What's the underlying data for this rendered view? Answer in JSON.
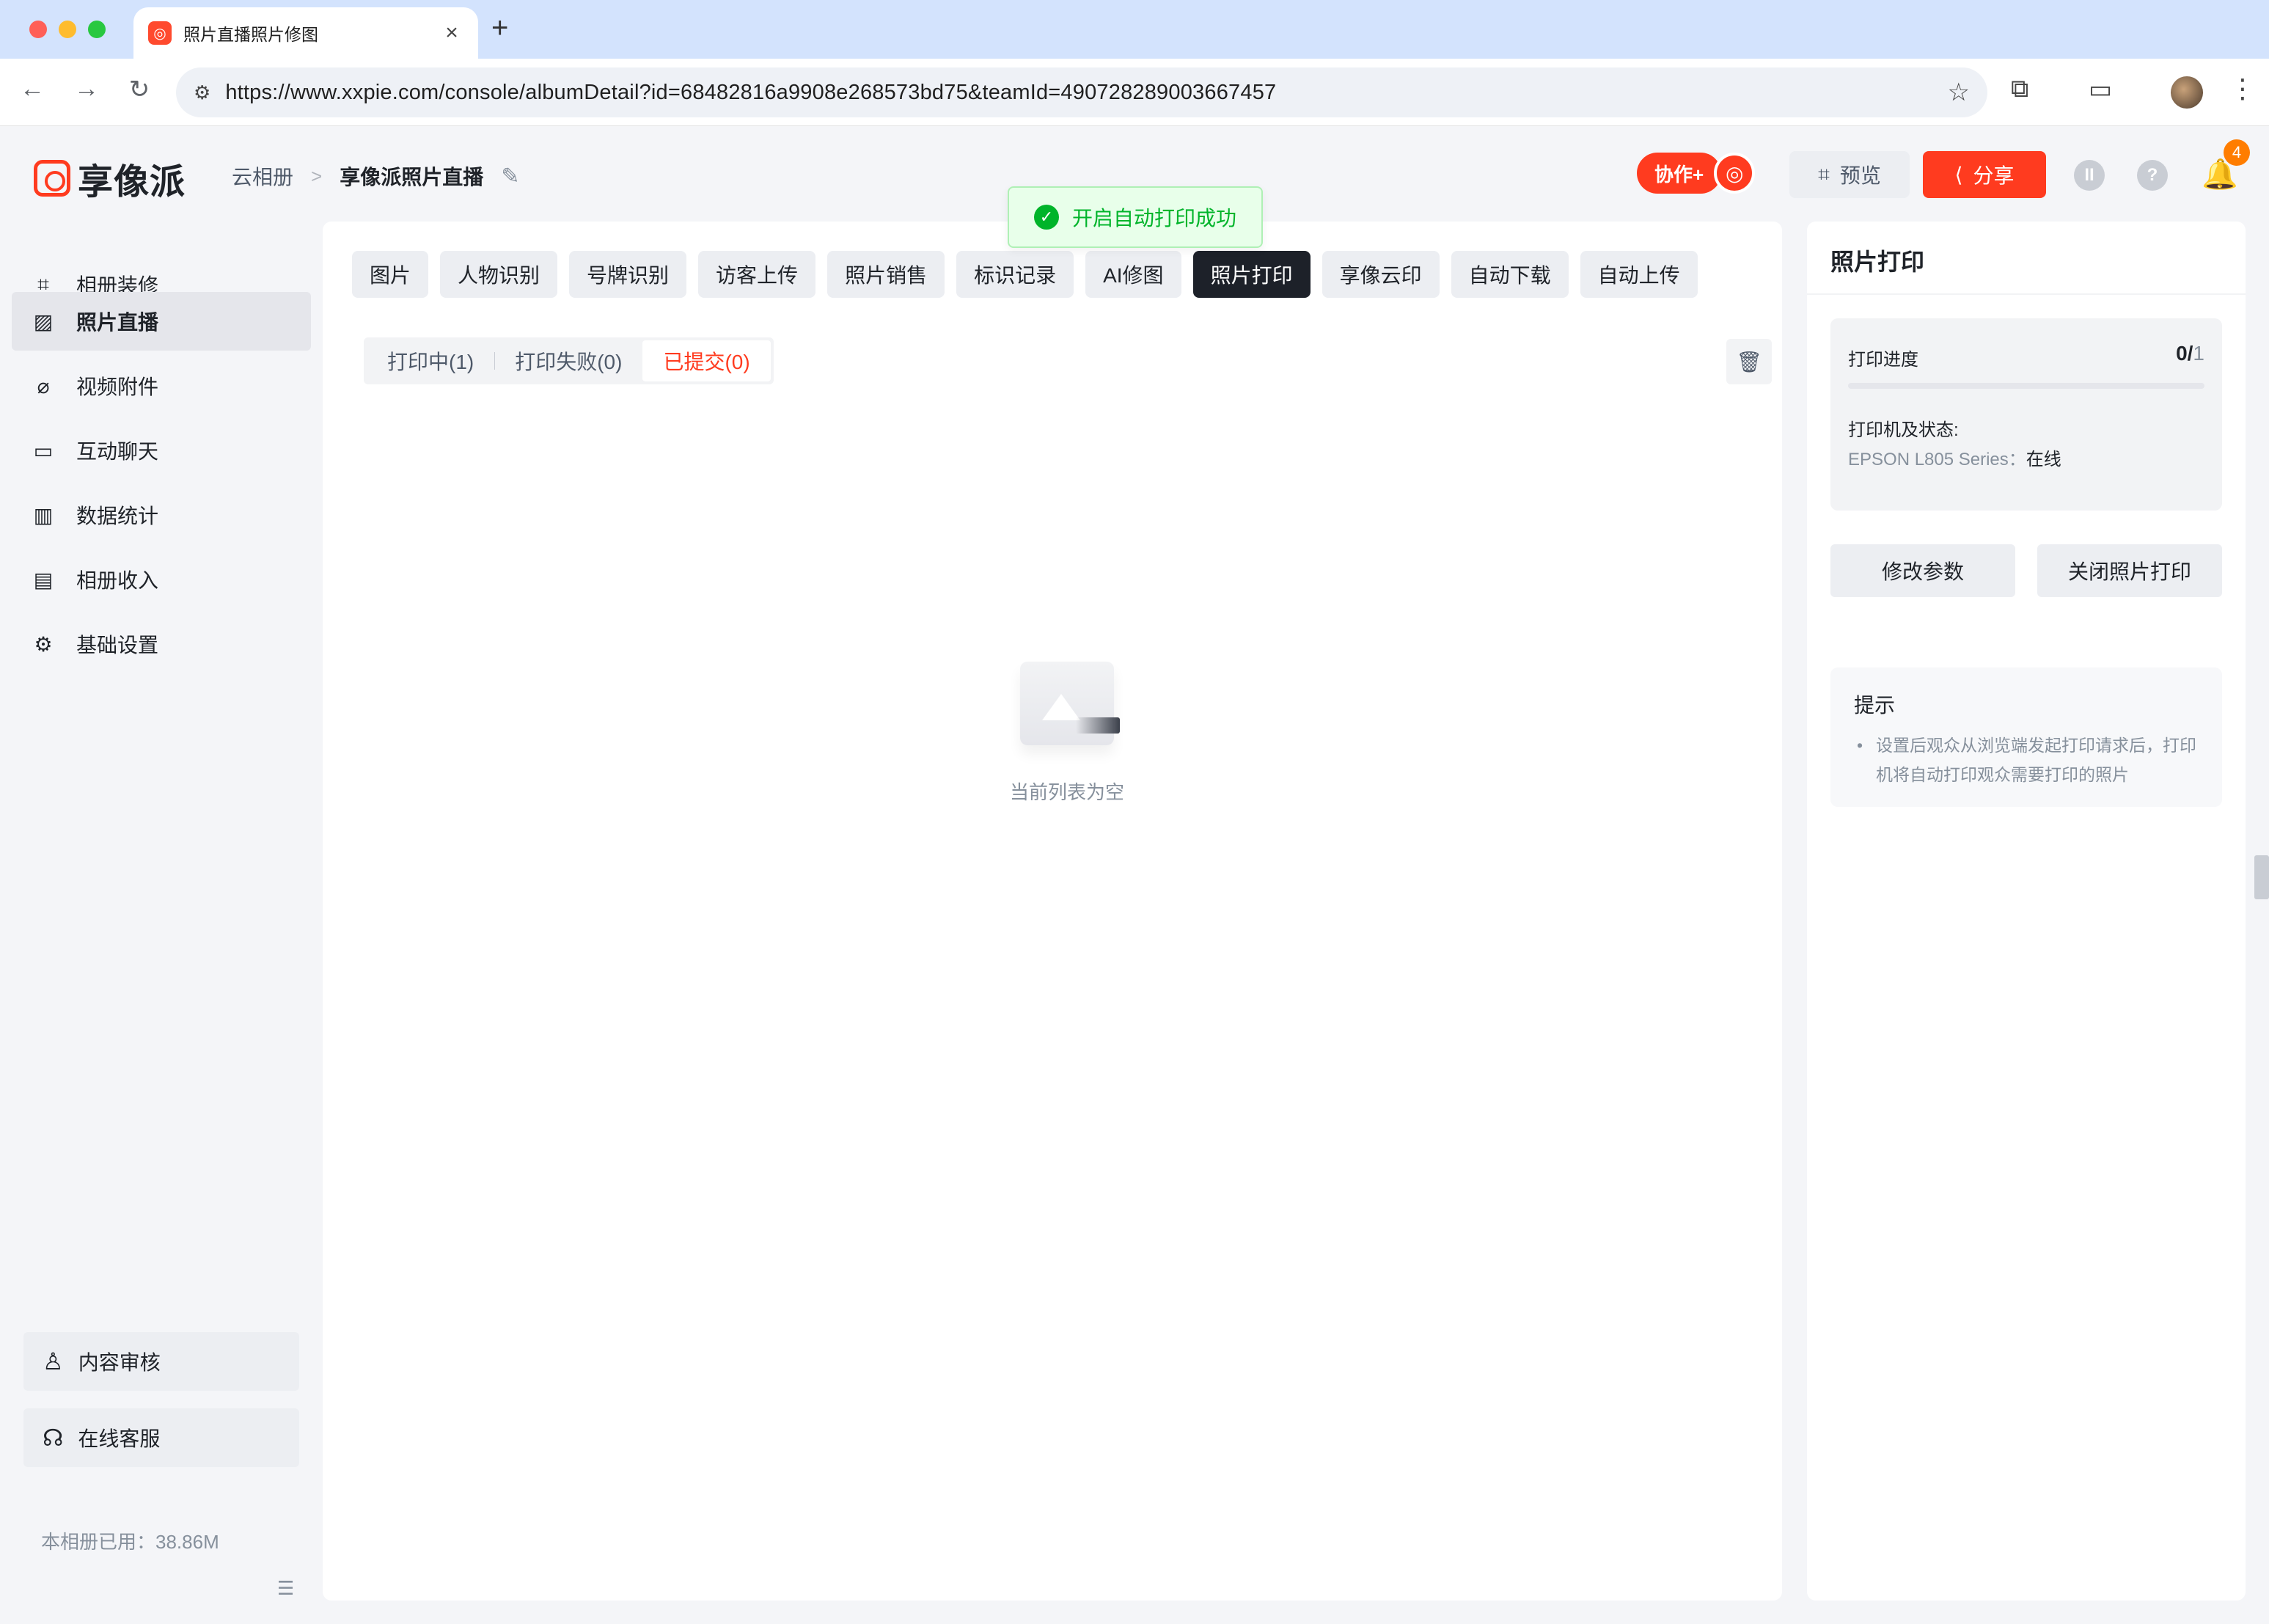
{
  "browser": {
    "tab_title": "照片直播照片修图",
    "tab_close": "×",
    "new_tab": "+",
    "url": "https://www.xxpie.com/console/albumDetail?id=68482816a9908e268573bd75&teamId=490728289003667457"
  },
  "header": {
    "logo_text": "享像派",
    "breadcrumb": [
      "云相册",
      "享像派照片直播"
    ],
    "breadcrumb_sep": ">",
    "collab_label": "协作+",
    "preview_label": "预览",
    "share_label": "分享",
    "notification_count": "4",
    "user_initial": "II",
    "help_glyph": "?"
  },
  "sidebar": {
    "items": [
      {
        "label": "相册装修",
        "icon": "decorate-icon"
      },
      {
        "label": "照片直播",
        "icon": "image-icon"
      },
      {
        "label": "视频附件",
        "icon": "paperclip-icon"
      },
      {
        "label": "互动聊天",
        "icon": "chat-icon"
      },
      {
        "label": "数据统计",
        "icon": "chart-icon"
      },
      {
        "label": "相册收入",
        "icon": "wallet-icon"
      },
      {
        "label": "基础设置",
        "icon": "gear-icon"
      }
    ],
    "active_index": 1,
    "content_review_label": "内容审核",
    "online_service_label": "在线客服",
    "usage_text": "本相册已用：38.86M"
  },
  "main": {
    "function_tabs": [
      "图片",
      "人物识别",
      "号牌识别",
      "访客上传",
      "照片销售",
      "标识记录",
      "AI修图",
      "照片打印",
      "享像云印",
      "自动下载",
      "自动上传"
    ],
    "active_function_tab": 7,
    "sub_tabs": [
      "打印中(1)",
      "打印失败(0)",
      "已提交(0)"
    ],
    "active_sub_tab": 2,
    "empty_text": "当前列表为空"
  },
  "toast": {
    "message": "开启自动打印成功"
  },
  "print_panel": {
    "title": "照片打印",
    "progress_label": "打印进度",
    "progress_done": "0/",
    "progress_total": "1",
    "progress_fraction": 0,
    "printer_label": "打印机及状态:",
    "printer_name": "EPSON L805 Series：",
    "printer_status": "在线",
    "modify_button": "修改参数",
    "close_button": "关闭照片打印",
    "tips_title": "提示",
    "tips_text": "设置后观众从浏览端发起打印请求后，打印机将自动打印观众需要打印的照片"
  },
  "colors": {
    "brand": "#ff3b1f",
    "success": "#00b42a",
    "dark_tab": "#1d2129"
  }
}
